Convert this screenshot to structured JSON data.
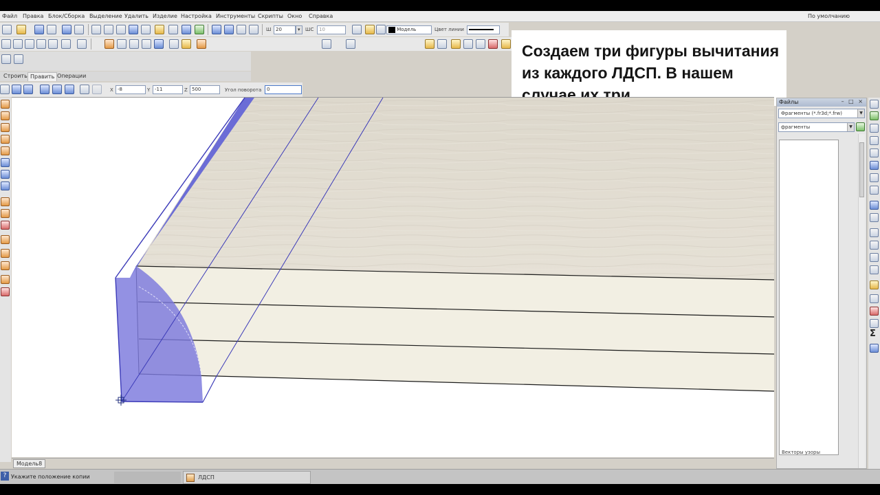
{
  "menu": [
    "Файл",
    "Правка",
    "Блок/Сборка",
    "Выделение",
    "Удалить",
    "Изделие",
    "Настройка",
    "Инструменты",
    "Скрипты",
    "Окно",
    "Справка"
  ],
  "profile": "По умолчанию",
  "props": {
    "w_label": "Ш",
    "w_value": "20",
    "ws_label": "ШС",
    "ws_value": "10",
    "layer": "Модель",
    "line_color_label": "Цвет линии"
  },
  "tabs": [
    "Строить",
    "Править",
    "Операции"
  ],
  "coords": {
    "x_label": "X",
    "x_value": "-8",
    "y_label": "Y",
    "y_value": "-11",
    "z_label": "Z",
    "z_value": "500",
    "angle_label": "Угол поворота",
    "angle_value": "0"
  },
  "caption": "Создаем три фигуры вычитания из каждого ЛДСП. В нашем случае их три.",
  "files_panel": {
    "title": "Файлы",
    "controls": "– □ ×",
    "filter": "Фрагменты (*.fr3d;*.frw)",
    "folder": "фрагменты",
    "item": "Векторы узоры"
  },
  "model_tab": "Модель8",
  "status": {
    "help_icon": "?",
    "text": "Укажите положение копии",
    "document": "ЛДСП"
  },
  "colors": {
    "selection_fill": "#7b79dd",
    "selection_edge": "#3b3ab8",
    "board_front": "#f2efe3",
    "board_top": "#e2ddd2",
    "toolbar_bg": "#e8e8e8"
  }
}
